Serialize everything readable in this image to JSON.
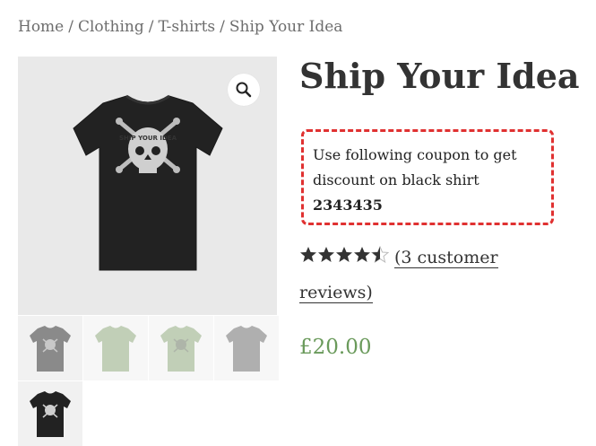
{
  "breadcrumb": {
    "items": [
      "Home",
      "Clothing",
      "T-shirts",
      "Ship Your Idea"
    ],
    "separator": "/"
  },
  "product": {
    "title": "Ship Your Idea",
    "shirt_print_text": "SHIP YOUR IDEA",
    "coupon": {
      "text": "Use following coupon to get discount on black shirt",
      "code": "2343435"
    },
    "rating": {
      "stars": 4.5,
      "max": 5,
      "reviews_label": "(3 customer reviews)"
    },
    "price": "£20.00"
  },
  "gallery": {
    "zoom_icon": "search-icon",
    "thumbnails": [
      {
        "name": "grey-shirt-thumbnail",
        "color": "#8a8a8a"
      },
      {
        "name": "green-shirt-thumbnail",
        "color": "#b3c2a8"
      },
      {
        "name": "green-skull-shirt-thumbnail",
        "color": "#b3c2a8"
      },
      {
        "name": "grey-plain-shirt-thumbnail",
        "color": "#8a8a8a"
      },
      {
        "name": "black-shirt-thumbnail",
        "color": "#222222"
      }
    ]
  },
  "colors": {
    "coupon_border": "#e03131",
    "price": "#6a9a5b",
    "star": "#333333"
  }
}
